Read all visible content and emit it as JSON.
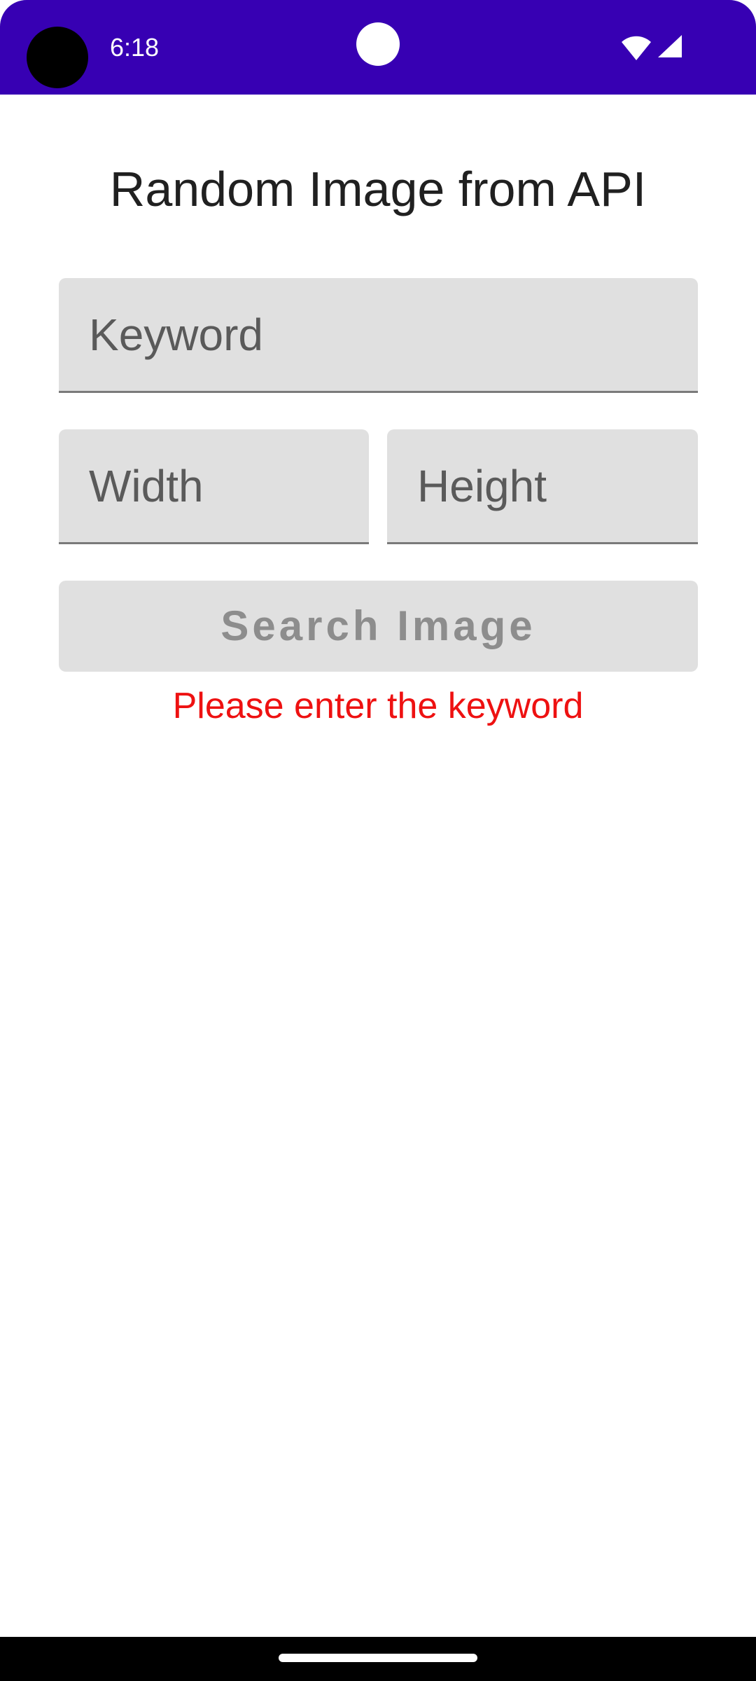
{
  "status_bar": {
    "time": "6:18",
    "background": "#3700b3",
    "icons": [
      "camera-cutout",
      "wifi-icon",
      "cell-signal-icon"
    ]
  },
  "screen": {
    "title": "Random Image from API",
    "keyword_input": {
      "placeholder": "Keyword",
      "value": ""
    },
    "width_input": {
      "placeholder": "Width",
      "value": ""
    },
    "height_input": {
      "placeholder": "Height",
      "value": ""
    },
    "search_button": {
      "label": "Search Image",
      "enabled": false
    },
    "error_message": "Please enter the keyword",
    "error_color": "#ee1111"
  },
  "navigation_bar": {
    "icons": [
      "home-indicator"
    ]
  }
}
